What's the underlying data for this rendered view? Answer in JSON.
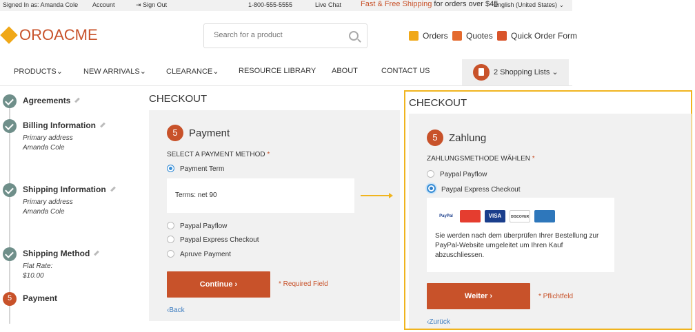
{
  "topbar": {
    "signed_in": "Signed In as: Amanda Cole",
    "account": "Account",
    "sign_out": "Sign Out",
    "phone": "1-800-555-5555",
    "live_chat": "Live Chat",
    "promo_highlight": "Fast & Free Shipping",
    "promo_rest": " for orders over $45",
    "language": "English (United States)"
  },
  "header": {
    "logo_oro": "ORO",
    "logo_acme": "ACME",
    "search_placeholder": "Search for a product",
    "orders": "Orders",
    "quotes": "Quotes",
    "quick_order": "Quick Order Form"
  },
  "nav": {
    "products": "PRODUCTS",
    "new_arrivals": "NEW ARRIVALS",
    "clearance": "CLEARANCE",
    "resource_library": "RESOURCE LIBRARY",
    "about": "ABOUT",
    "contact": "CONTACT US",
    "shopping_lists": "2 Shopping Lists"
  },
  "steps": {
    "agreements": "Agreements",
    "billing": "Billing Information",
    "billing_l1": "Primary address",
    "billing_l2": "Amanda Cole",
    "shipping": "Shipping Information",
    "shipping_l1": "Primary address",
    "shipping_l2": "Amanda Cole",
    "method": "Shipping Method",
    "method_l1": "Flat Rate:",
    "method_l2": "$10.00",
    "payment_num": "5",
    "payment": "Payment"
  },
  "en": {
    "heading": "CHECKOUT",
    "step_num": "5",
    "title": "Payment",
    "select_label": "SELECT A PAYMENT METHOD",
    "req_mark": "*",
    "opt_term": "Payment Term",
    "terms_text": "Terms: net 90",
    "opt_payflow": "Paypal Payflow",
    "opt_express": "Paypal Express Checkout",
    "opt_apruve": "Apruve Payment",
    "continue": "Continue",
    "required": "* Required Field",
    "back": "Back"
  },
  "de": {
    "heading": "CHECKOUT",
    "step_num": "5",
    "title": "Zahlung",
    "select_label": "ZAHLUNGSMETHODE WÄHLEN",
    "req_mark": "*",
    "opt_payflow": "Paypal Payflow",
    "opt_express": "Paypal Express Checkout",
    "card_paypal": "PayPal",
    "card_visa": "VISA",
    "card_discover": "DISCOVER",
    "redirect_text_1": "Sie werden nach dem überprüfen Ihrer Bestellung zur",
    "redirect_text_2": "PayPal-Website umgeleitet um Ihren Kauf",
    "redirect_text_3": "abzuschliessen.",
    "continue": "Weiter",
    "required": "* Pflichtfeld",
    "back": "Zurück"
  }
}
